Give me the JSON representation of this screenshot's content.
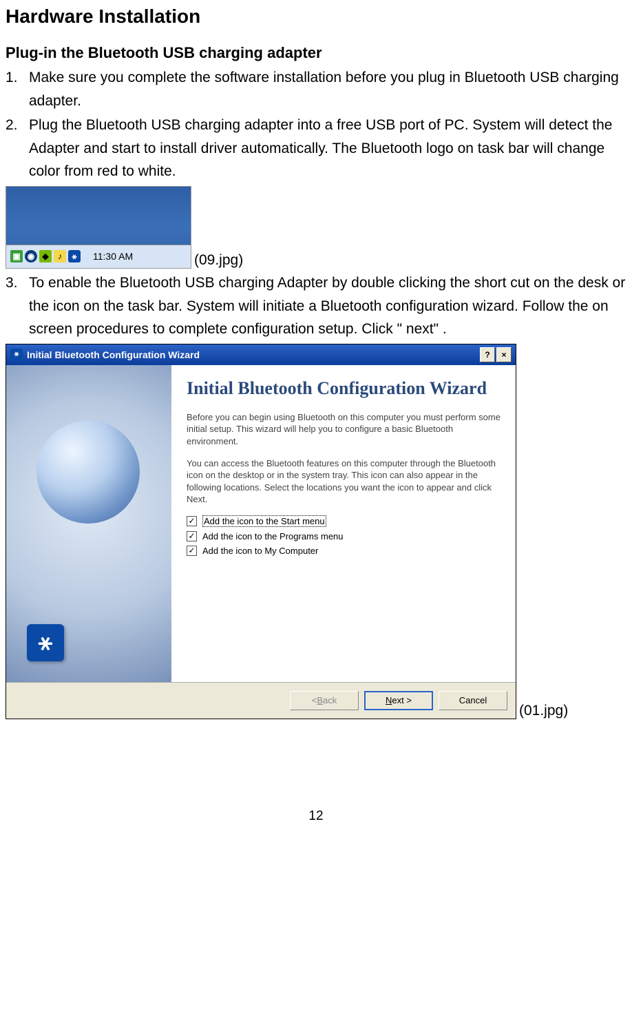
{
  "title": "Hardware Installation",
  "subtitle": "Plug-in the Bluetooth USB charging adapter",
  "steps": {
    "1": {
      "num": "1.",
      "text": "Make sure you complete the software installation before you plug in Bluetooth USB charging adapter."
    },
    "2": {
      "num": "2.",
      "text": "Plug the Bluetooth USB charging adapter into a free USB port of PC. System will detect the Adapter and start to install driver automatically. The Bluetooth logo on task bar will change color from red to white."
    },
    "3": {
      "num": "3.",
      "text": "To enable the Bluetooth USB charging Adapter by double clicking the short cut on the desk or the icon on the task bar. System will initiate a Bluetooth configuration wizard. Follow the on screen procedures to complete configuration setup. Click \" next\" ."
    }
  },
  "taskbar": {
    "time": "11:30 AM",
    "caption": "(09.jpg)"
  },
  "wizard": {
    "title": "Initial Bluetooth Configuration Wizard",
    "heading": "Initial Bluetooth Configuration Wizard",
    "p1": "Before you can begin using Bluetooth on this computer you must perform some initial setup. This wizard will help you to configure a basic Bluetooth environment.",
    "p2": "You can access the Bluetooth features on this computer through the Bluetooth icon on the desktop or in the system tray. This icon can also appear in the following locations. Select the locations you want the icon to appear and click Next.",
    "checks": {
      "start": "Add the icon to the Start menu",
      "programs": "Add the icon to the Programs menu",
      "mycomputer": "Add the icon to My Computer"
    },
    "buttons": {
      "back": "< Back",
      "next": "Next >",
      "cancel": "Cancel"
    },
    "caption": "(01.jpg)"
  },
  "pageNumber": "12",
  "glyphs": {
    "bt": "⚹",
    "check": "✓"
  }
}
